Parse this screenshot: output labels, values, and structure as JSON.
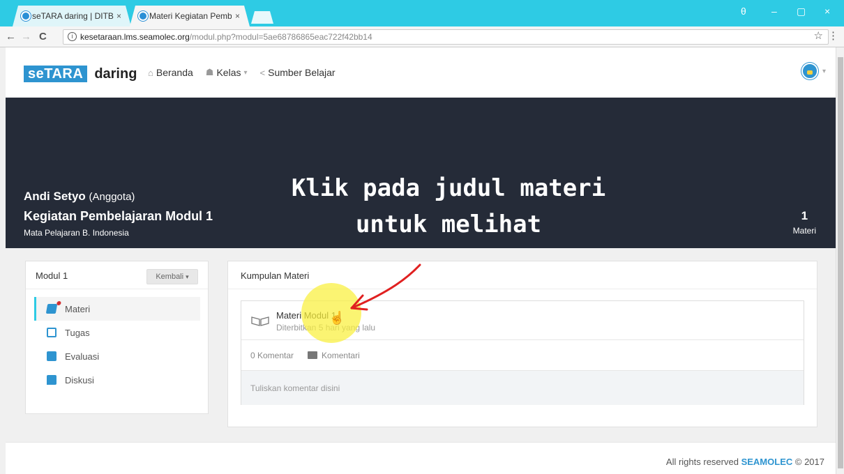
{
  "browser": {
    "tabs": [
      {
        "title": "seTARA daring | DITBIND",
        "close": "×",
        "active": false
      },
      {
        "title": "Materi Kegiatan Pembela",
        "close": "×",
        "active": true
      }
    ],
    "url_host": "kesetaraan.lms.seamolec.org",
    "url_path": "/modul.php?modul=5ae68786865eac722f42bb14",
    "nav": {
      "back": "←",
      "forward": "→",
      "reload": "C",
      "star": "☆",
      "menu": "⋮"
    },
    "window_controls": {
      "profile": "θ",
      "minimize": "–",
      "restore": "▢",
      "close": "×"
    }
  },
  "site": {
    "logo_box": "seTARA",
    "logo_word": "daring",
    "nav": [
      {
        "label": "Beranda",
        "icon": "home-icon"
      },
      {
        "label": "Kelas",
        "icon": "users-icon"
      },
      {
        "label": "Sumber Belajar",
        "icon": "share-icon"
      }
    ],
    "caret": "▾"
  },
  "hero": {
    "name": "Andi Setyo",
    "role": "(Anggota)",
    "course": "Kegiatan Pembelajaran Modul 1",
    "subject": "Mata Pelajaran B. Indonesia",
    "overlay_line1": "Klik pada judul materi",
    "overlay_line2": "untuk melihat",
    "count_value": "1",
    "count_label": "Materi"
  },
  "sidebar": {
    "title": "Modul 1",
    "back_button": "Kembali",
    "items": [
      {
        "label": "Materi",
        "icon": "book-icon"
      },
      {
        "label": "Tugas",
        "icon": "document-icon"
      },
      {
        "label": "Evaluasi",
        "icon": "clipboard-icon"
      },
      {
        "label": "Diskusi",
        "icon": "chat-icon"
      }
    ]
  },
  "main": {
    "title": "Kumpulan Materi",
    "material": {
      "title": "Materi Modul 1",
      "published": "Diterbitkan 5 hari yang lalu",
      "comment_count": "0 Komentar",
      "comment_button": "Komentari",
      "comment_placeholder": "Tuliskan komentar disini"
    }
  },
  "footer": {
    "text": "All rights reserved",
    "brand": "SEAMOLEC",
    "year": "© 2017"
  },
  "colors": {
    "chrome_tab_bar": "#2ecbe4",
    "brand_blue": "#2e94d0",
    "hero_bg": "#252b38",
    "highlight": "#faf03c",
    "arrow": "#e02020"
  }
}
